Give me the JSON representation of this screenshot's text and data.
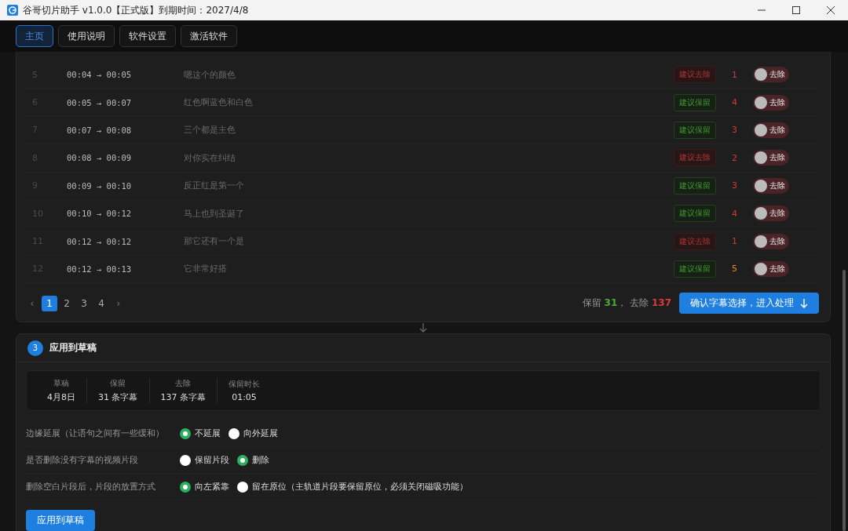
{
  "window": {
    "title": "谷哥切片助手 v1.0.0【正式版】到期时间：2027/4/8"
  },
  "tabs": [
    {
      "label": "主页",
      "selected": true
    },
    {
      "label": "使用说明",
      "selected": false
    },
    {
      "label": "软件设置",
      "selected": false
    },
    {
      "label": "激活软件",
      "selected": false
    }
  ],
  "subtitle_table": {
    "rows": [
      {
        "index": "5",
        "time": "00:04 → 00:05",
        "text": "嗯这个的颜色",
        "suggestion": "建议去除",
        "kind": "remove",
        "score": "1",
        "color": "#d03a3a",
        "toggle_label": "去除",
        "on": false
      },
      {
        "index": "6",
        "time": "00:05 → 00:07",
        "text": "红色啊蓝色和白色",
        "suggestion": "建议保留",
        "kind": "keep",
        "score": "4",
        "color": "#d03a3a",
        "toggle_label": "去除",
        "on": false
      },
      {
        "index": "7",
        "time": "00:07 → 00:08",
        "text": "三个都是主色",
        "suggestion": "建议保留",
        "kind": "keep",
        "score": "3",
        "color": "#d03a3a",
        "toggle_label": "去除",
        "on": false
      },
      {
        "index": "8",
        "time": "00:08 → 00:09",
        "text": "对你实在纠结",
        "suggestion": "建议去除",
        "kind": "remove",
        "score": "2",
        "color": "#d03a3a",
        "toggle_label": "去除",
        "on": false
      },
      {
        "index": "9",
        "time": "00:09 → 00:10",
        "text": "反正红是第一个",
        "suggestion": "建议保留",
        "kind": "keep",
        "score": "3",
        "color": "#d03a3a",
        "toggle_label": "去除",
        "on": false
      },
      {
        "index": "10",
        "time": "00:10 → 00:12",
        "text": "马上也到圣诞了",
        "suggestion": "建议保留",
        "kind": "keep",
        "score": "4",
        "color": "#d03a3a",
        "toggle_label": "去除",
        "on": false
      },
      {
        "index": "11",
        "time": "00:12 → 00:12",
        "text": "那它还有一个是",
        "suggestion": "建议去除",
        "kind": "remove",
        "score": "1",
        "color": "#d03a3a",
        "toggle_label": "去除",
        "on": false
      },
      {
        "index": "12",
        "time": "00:12 → 00:13",
        "text": "它非常好搭",
        "suggestion": "建议保留",
        "kind": "keep",
        "score": "5",
        "color": "#e8892a",
        "toggle_label": "去除",
        "on": false
      }
    ],
    "pagination": {
      "prev": "‹",
      "next": "›",
      "pages": [
        {
          "label": "1",
          "selected": true
        },
        {
          "label": "2",
          "selected": false
        },
        {
          "label": "3",
          "selected": false
        },
        {
          "label": "4",
          "selected": false
        }
      ]
    },
    "summary": {
      "keep_label": "保留",
      "keep_count": "31",
      "separator": "，",
      "remove_label": "去除",
      "remove_count": "137"
    },
    "confirm_button": "确认字幕选择，进入处理"
  },
  "apply_section": {
    "step": "3",
    "title": "应用到草稿",
    "stats": [
      {
        "label": "草稿",
        "value": "4月8日"
      },
      {
        "label": "保留",
        "value": "31 条字幕"
      },
      {
        "label": "去除",
        "value": "137 条字幕"
      },
      {
        "label": "保留时长",
        "value": "01:05"
      }
    ],
    "options": [
      {
        "label": "边缘延展（让语句之间有一些缓和）",
        "choices": [
          {
            "label": "不延展",
            "selected": true
          },
          {
            "label": "向外延展",
            "selected": false
          }
        ]
      },
      {
        "label": "是否删除没有字幕的视频片段",
        "choices": [
          {
            "label": "保留片段",
            "selected": false
          },
          {
            "label": "删除",
            "selected": true
          }
        ]
      },
      {
        "label": "删除空白片段后，片段的放置方式",
        "choices": [
          {
            "label": "向左紧靠",
            "selected": true
          },
          {
            "label": "留在原位（主轨道片段要保留原位，必须关闭磁吸功能）",
            "selected": false
          }
        ]
      }
    ],
    "apply_button": "应用到草稿"
  }
}
